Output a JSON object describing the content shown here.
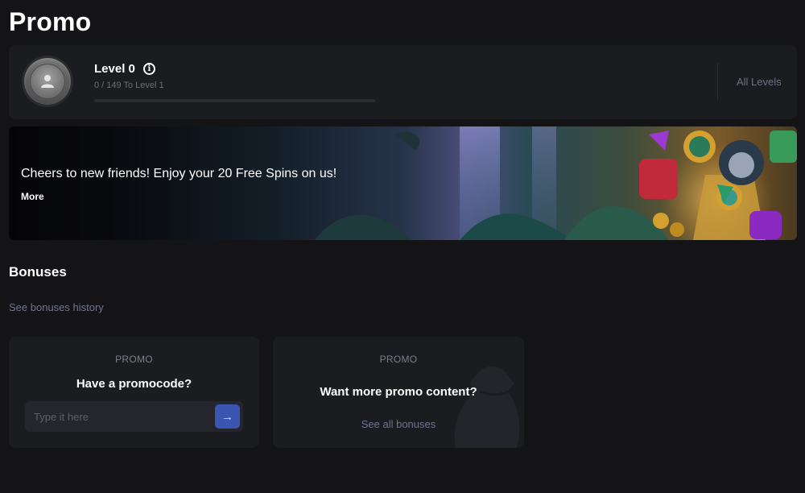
{
  "page": {
    "title": "Promo"
  },
  "level": {
    "title": "Level 0",
    "progress_text": "0 / 149 To Level 1",
    "progress_fraction": 0,
    "all_levels_label": "All Levels",
    "info_icon": "info-icon",
    "avatar_icon": "user-badge-icon"
  },
  "banner": {
    "text": "Cheers to new friends! Enjoy your 20 Free Spins on us!",
    "more_label": "More"
  },
  "bonuses": {
    "title": "Bonuses",
    "history_link": "See bonuses history",
    "promocode_card": {
      "label": "PROMO",
      "heading": "Have a promocode?",
      "input_placeholder": "Type it here",
      "submit_icon": "arrow-right-icon"
    },
    "content_card": {
      "label": "PROMO",
      "heading": "Want more promo content?",
      "link": "See all bonuses"
    }
  },
  "colors": {
    "background": "#141417",
    "card": "#1b1c20",
    "accent_button": "#3b56b0",
    "muted_link": "#6f7490"
  }
}
